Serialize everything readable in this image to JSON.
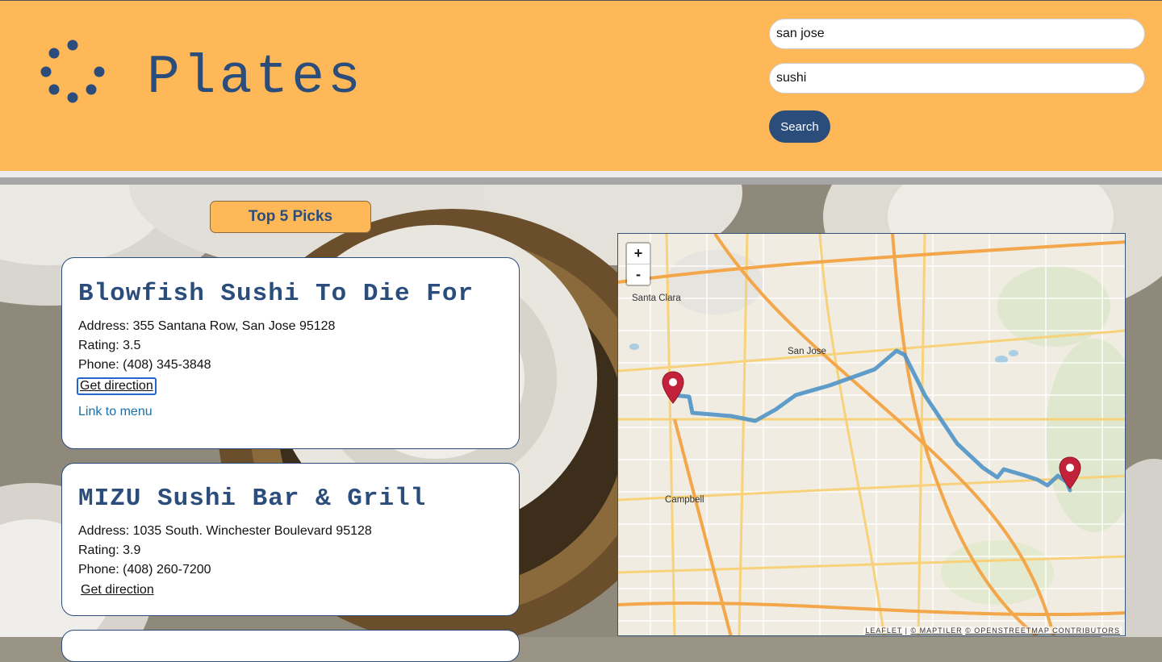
{
  "header": {
    "logo_text": "Plates",
    "location_value": "san jose",
    "food_value": "sushi",
    "search_label": "Search"
  },
  "picks": {
    "title": "Top 5 Picks",
    "restaurants": [
      {
        "name": "Blowfish Sushi To Die For",
        "address": "Address: 355 Santana Row, San Jose 95128",
        "rating": "Rating: 3.5",
        "phone": "Phone: (408) 345-3848",
        "direction": "Get direction",
        "menu": "Link to menu"
      },
      {
        "name": "MIZU Sushi Bar & Grill",
        "address": "Address: 1035 South. Winchester Boulevard 95128",
        "rating": "Rating: 3.9",
        "phone": "Phone: (408) 260-7200",
        "direction": "Get direction"
      }
    ]
  },
  "map": {
    "zoom_in": "+",
    "zoom_out": "-",
    "attribution_leaflet": "LEAFLET",
    "attribution_sep": " | ",
    "attribution_maptiler": "© MAPTILER",
    "attribution_osm": "© OPENSTREETMAP CONTRIBUTORS",
    "labels": {
      "santa_clara": "Santa Clara",
      "san_jose": "San Jose",
      "campbell": "Campbell"
    },
    "route_color": "#4f93c6",
    "marker_color": "#c3233a"
  },
  "colors": {
    "header_bg": "#FEB857",
    "brand_blue": "#2a4d7c"
  }
}
